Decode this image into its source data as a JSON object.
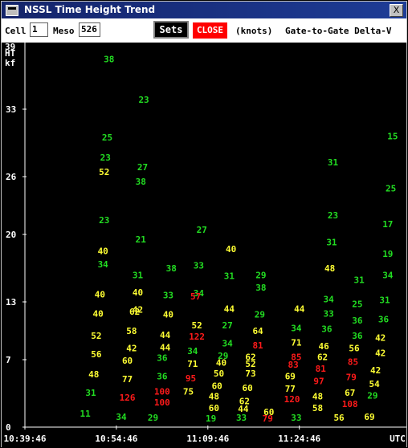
{
  "window": {
    "title": "NSSL Time Height Trend",
    "close_glyph": "X"
  },
  "toolbar": {
    "cell_label": "Cell",
    "cell_value": "1",
    "meso_label": "Meso",
    "meso_value": "526",
    "sets_label": "Sets",
    "close_label": "CLOSE",
    "units_label": "(knots)",
    "mode_label": "Gate-to-Gate Delta-V"
  },
  "colors": {
    "green": "#22dd22",
    "yellow": "#ffff33",
    "red": "#ff1a1a",
    "axis": "#ffffff",
    "background": "#000000"
  },
  "chart_data": {
    "type": "scatter",
    "title": "Gate-to-Gate Delta-V",
    "units": "(knots)",
    "y_axis_label": [
      "HT",
      "kf"
    ],
    "y_top_tick": "39",
    "y_ticks": [
      "33",
      "26",
      "20",
      "13",
      "7",
      "0"
    ],
    "y_tick_values": [
      33,
      26,
      20,
      13,
      7,
      0
    ],
    "ylim": [
      0,
      39.5
    ],
    "x_ticks": [
      "10:39:46",
      "10:54:46",
      "11:09:46",
      "11:24:46"
    ],
    "x_tick_values": [
      0,
      15,
      30,
      45
    ],
    "x_unit": "UTC",
    "xlim": [
      0,
      61.5
    ],
    "points": [
      {
        "x": 13.8,
        "y": 38.2,
        "v": "38",
        "c": "green"
      },
      {
        "x": 13.5,
        "y": 30.1,
        "v": "25",
        "c": "green"
      },
      {
        "x": 13.2,
        "y": 28.0,
        "v": "23",
        "c": "green"
      },
      {
        "x": 13.0,
        "y": 26.5,
        "v": "52",
        "c": "yellow"
      },
      {
        "x": 13.0,
        "y": 21.5,
        "v": "23",
        "c": "green"
      },
      {
        "x": 12.8,
        "y": 18.3,
        "v": "40",
        "c": "yellow"
      },
      {
        "x": 12.8,
        "y": 16.9,
        "v": "34",
        "c": "green"
      },
      {
        "x": 12.3,
        "y": 13.8,
        "v": "40",
        "c": "yellow"
      },
      {
        "x": 12.0,
        "y": 11.8,
        "v": "40",
        "c": "yellow"
      },
      {
        "x": 11.7,
        "y": 9.5,
        "v": "52",
        "c": "yellow"
      },
      {
        "x": 11.7,
        "y": 7.6,
        "v": "56",
        "c": "yellow"
      },
      {
        "x": 11.3,
        "y": 5.5,
        "v": "48",
        "c": "yellow"
      },
      {
        "x": 10.8,
        "y": 3.6,
        "v": "31",
        "c": "green"
      },
      {
        "x": 9.9,
        "y": 1.4,
        "v": "11",
        "c": "green"
      },
      {
        "x": 19.5,
        "y": 34.0,
        "v": "23",
        "c": "green"
      },
      {
        "x": 19.3,
        "y": 27.0,
        "v": "27",
        "c": "green"
      },
      {
        "x": 19.0,
        "y": 25.5,
        "v": "38",
        "c": "green"
      },
      {
        "x": 19.0,
        "y": 19.5,
        "v": "21",
        "c": "green"
      },
      {
        "x": 18.5,
        "y": 15.8,
        "v": "31",
        "c": "green"
      },
      {
        "x": 18.5,
        "y": 14.0,
        "v": "40",
        "c": "yellow"
      },
      {
        "x": 18.0,
        "y": 12.0,
        "v": "62",
        "c": "yellow"
      },
      {
        "x": 18.5,
        "y": 12.2,
        "v": "42",
        "c": "yellow"
      },
      {
        "x": 17.5,
        "y": 10.0,
        "v": "58",
        "c": "yellow"
      },
      {
        "x": 17.5,
        "y": 8.2,
        "v": "42",
        "c": "yellow"
      },
      {
        "x": 16.8,
        "y": 6.9,
        "v": "60",
        "c": "yellow"
      },
      {
        "x": 16.8,
        "y": 5.0,
        "v": "77",
        "c": "yellow"
      },
      {
        "x": 16.8,
        "y": 3.1,
        "v": "126",
        "c": "red"
      },
      {
        "x": 15.8,
        "y": 1.1,
        "v": "34",
        "c": "green"
      },
      {
        "x": 24.0,
        "y": 16.5,
        "v": "38",
        "c": "green"
      },
      {
        "x": 23.5,
        "y": 13.7,
        "v": "33",
        "c": "green"
      },
      {
        "x": 23.5,
        "y": 11.7,
        "v": "40",
        "c": "yellow"
      },
      {
        "x": 23.0,
        "y": 9.6,
        "v": "44",
        "c": "yellow"
      },
      {
        "x": 23.0,
        "y": 8.3,
        "v": "44",
        "c": "yellow"
      },
      {
        "x": 22.5,
        "y": 7.2,
        "v": "36",
        "c": "green"
      },
      {
        "x": 22.5,
        "y": 5.3,
        "v": "36",
        "c": "green"
      },
      {
        "x": 22.5,
        "y": 3.7,
        "v": "100",
        "c": "red"
      },
      {
        "x": 22.5,
        "y": 2.6,
        "v": "100",
        "c": "red"
      },
      {
        "x": 21.0,
        "y": 1.0,
        "v": "29",
        "c": "green"
      },
      {
        "x": 29.0,
        "y": 20.5,
        "v": "27",
        "c": "green"
      },
      {
        "x": 28.5,
        "y": 16.8,
        "v": "33",
        "c": "green"
      },
      {
        "x": 28.5,
        "y": 13.9,
        "v": "34",
        "c": "green"
      },
      {
        "x": 28.0,
        "y": 13.6,
        "v": "57",
        "c": "red"
      },
      {
        "x": 28.2,
        "y": 10.6,
        "v": "52",
        "c": "yellow"
      },
      {
        "x": 28.2,
        "y": 9.4,
        "v": "122",
        "c": "red"
      },
      {
        "x": 27.5,
        "y": 7.9,
        "v": "34",
        "c": "green"
      },
      {
        "x": 27.5,
        "y": 6.6,
        "v": "71",
        "c": "yellow"
      },
      {
        "x": 27.2,
        "y": 5.1,
        "v": "95",
        "c": "red"
      },
      {
        "x": 26.8,
        "y": 3.7,
        "v": "75",
        "c": "yellow"
      },
      {
        "x": 30.5,
        "y": 0.9,
        "v": "19",
        "c": "green"
      },
      {
        "x": 33.8,
        "y": 18.5,
        "v": "40",
        "c": "yellow"
      },
      {
        "x": 33.5,
        "y": 15.7,
        "v": "31",
        "c": "green"
      },
      {
        "x": 33.5,
        "y": 12.3,
        "v": "44",
        "c": "yellow"
      },
      {
        "x": 33.2,
        "y": 10.6,
        "v": "27",
        "c": "green"
      },
      {
        "x": 33.2,
        "y": 8.7,
        "v": "34",
        "c": "green"
      },
      {
        "x": 32.5,
        "y": 7.4,
        "v": "29",
        "c": "green"
      },
      {
        "x": 32.2,
        "y": 6.7,
        "v": "40",
        "c": "yellow"
      },
      {
        "x": 31.8,
        "y": 5.6,
        "v": "50",
        "c": "yellow"
      },
      {
        "x": 31.5,
        "y": 4.3,
        "v": "60",
        "c": "yellow"
      },
      {
        "x": 31.0,
        "y": 3.2,
        "v": "48",
        "c": "yellow"
      },
      {
        "x": 31.0,
        "y": 2.0,
        "v": "60",
        "c": "yellow"
      },
      {
        "x": 35.5,
        "y": 1.0,
        "v": "33",
        "c": "green"
      },
      {
        "x": 38.7,
        "y": 15.8,
        "v": "29",
        "c": "green"
      },
      {
        "x": 38.7,
        "y": 14.5,
        "v": "38",
        "c": "green"
      },
      {
        "x": 38.5,
        "y": 11.7,
        "v": "29",
        "c": "green"
      },
      {
        "x": 38.2,
        "y": 10.0,
        "v": "64",
        "c": "yellow"
      },
      {
        "x": 38.2,
        "y": 8.5,
        "v": "81",
        "c": "red"
      },
      {
        "x": 37.0,
        "y": 7.3,
        "v": "62",
        "c": "yellow"
      },
      {
        "x": 37.0,
        "y": 6.6,
        "v": "52",
        "c": "yellow"
      },
      {
        "x": 37.0,
        "y": 5.6,
        "v": "73",
        "c": "yellow"
      },
      {
        "x": 36.5,
        "y": 4.1,
        "v": "60",
        "c": "yellow"
      },
      {
        "x": 36.0,
        "y": 2.7,
        "v": "62",
        "c": "yellow"
      },
      {
        "x": 35.8,
        "y": 1.9,
        "v": "44",
        "c": "yellow"
      },
      {
        "x": 40.0,
        "y": 1.6,
        "v": "60",
        "c": "yellow"
      },
      {
        "x": 39.8,
        "y": 0.9,
        "v": "79",
        "c": "red"
      },
      {
        "x": 45.0,
        "y": 12.3,
        "v": "44",
        "c": "yellow"
      },
      {
        "x": 44.5,
        "y": 10.3,
        "v": "34",
        "c": "green"
      },
      {
        "x": 44.5,
        "y": 8.8,
        "v": "71",
        "c": "yellow"
      },
      {
        "x": 44.5,
        "y": 7.3,
        "v": "85",
        "c": "red"
      },
      {
        "x": 44.0,
        "y": 6.5,
        "v": "83",
        "c": "red"
      },
      {
        "x": 43.5,
        "y": 5.3,
        "v": "69",
        "c": "yellow"
      },
      {
        "x": 43.5,
        "y": 4.0,
        "v": "77",
        "c": "yellow"
      },
      {
        "x": 43.8,
        "y": 2.9,
        "v": "120",
        "c": "red"
      },
      {
        "x": 44.5,
        "y": 1.0,
        "v": "33",
        "c": "green"
      },
      {
        "x": 50.5,
        "y": 27.5,
        "v": "31",
        "c": "green"
      },
      {
        "x": 50.5,
        "y": 22.0,
        "v": "23",
        "c": "green"
      },
      {
        "x": 50.3,
        "y": 19.2,
        "v": "31",
        "c": "green"
      },
      {
        "x": 50.0,
        "y": 16.5,
        "v": "48",
        "c": "yellow"
      },
      {
        "x": 49.8,
        "y": 13.3,
        "v": "34",
        "c": "green"
      },
      {
        "x": 49.8,
        "y": 11.8,
        "v": "33",
        "c": "green"
      },
      {
        "x": 49.5,
        "y": 10.2,
        "v": "36",
        "c": "green"
      },
      {
        "x": 49.0,
        "y": 8.4,
        "v": "46",
        "c": "yellow"
      },
      {
        "x": 48.8,
        "y": 7.3,
        "v": "62",
        "c": "yellow"
      },
      {
        "x": 48.5,
        "y": 6.1,
        "v": "81",
        "c": "red"
      },
      {
        "x": 48.2,
        "y": 4.8,
        "v": "97",
        "c": "red"
      },
      {
        "x": 48.0,
        "y": 3.2,
        "v": "48",
        "c": "yellow"
      },
      {
        "x": 48.0,
        "y": 2.0,
        "v": "58",
        "c": "yellow"
      },
      {
        "x": 51.5,
        "y": 1.0,
        "v": "56",
        "c": "yellow"
      },
      {
        "x": 54.8,
        "y": 15.3,
        "v": "31",
        "c": "green"
      },
      {
        "x": 54.5,
        "y": 12.8,
        "v": "25",
        "c": "green"
      },
      {
        "x": 54.5,
        "y": 11.1,
        "v": "36",
        "c": "green"
      },
      {
        "x": 54.5,
        "y": 9.5,
        "v": "36",
        "c": "green"
      },
      {
        "x": 54.0,
        "y": 8.2,
        "v": "56",
        "c": "yellow"
      },
      {
        "x": 53.8,
        "y": 6.8,
        "v": "85",
        "c": "red"
      },
      {
        "x": 53.5,
        "y": 5.2,
        "v": "79",
        "c": "red"
      },
      {
        "x": 53.3,
        "y": 3.6,
        "v": "67",
        "c": "yellow"
      },
      {
        "x": 53.3,
        "y": 2.4,
        "v": "108",
        "c": "red"
      },
      {
        "x": 60.3,
        "y": 30.2,
        "v": "15",
        "c": "green"
      },
      {
        "x": 60.0,
        "y": 24.8,
        "v": "25",
        "c": "green"
      },
      {
        "x": 59.5,
        "y": 21.1,
        "v": "17",
        "c": "green"
      },
      {
        "x": 59.5,
        "y": 18.0,
        "v": "19",
        "c": "green"
      },
      {
        "x": 59.5,
        "y": 15.8,
        "v": "34",
        "c": "green"
      },
      {
        "x": 59.0,
        "y": 13.2,
        "v": "31",
        "c": "green"
      },
      {
        "x": 58.8,
        "y": 11.2,
        "v": "36",
        "c": "green"
      },
      {
        "x": 58.3,
        "y": 9.3,
        "v": "42",
        "c": "yellow"
      },
      {
        "x": 58.3,
        "y": 7.7,
        "v": "42",
        "c": "yellow"
      },
      {
        "x": 57.5,
        "y": 5.9,
        "v": "42",
        "c": "yellow"
      },
      {
        "x": 57.3,
        "y": 4.5,
        "v": "54",
        "c": "yellow"
      },
      {
        "x": 57.0,
        "y": 3.3,
        "v": "29",
        "c": "green"
      },
      {
        "x": 56.5,
        "y": 1.1,
        "v": "69",
        "c": "yellow"
      }
    ]
  }
}
